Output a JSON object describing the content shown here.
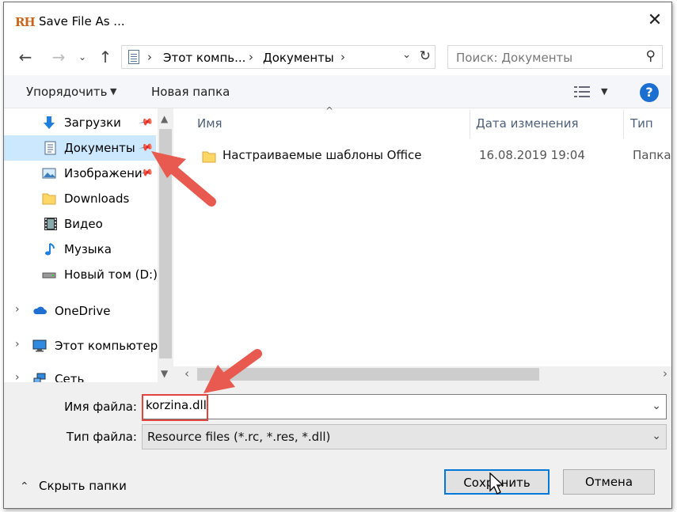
{
  "window": {
    "title": "Save File As ...",
    "app_icon_text": "RH"
  },
  "nav": {
    "breadcrumbs": [
      "Этот компь...",
      "Документы"
    ],
    "search_placeholder": "Поиск: Документы"
  },
  "toolbar": {
    "organize_label": "Упорядочить",
    "new_folder_label": "Новая папка"
  },
  "sidebar": {
    "items": [
      {
        "label": "Загрузки",
        "icon": "download-arrow-icon",
        "pinned": true
      },
      {
        "label": "Документы",
        "icon": "document-icon",
        "pinned": true,
        "selected": true
      },
      {
        "label": "Изображени",
        "icon": "pictures-icon",
        "pinned": true
      },
      {
        "label": "Downloads",
        "icon": "folder-icon"
      },
      {
        "label": "Видео",
        "icon": "video-icon"
      },
      {
        "label": "Музыка",
        "icon": "music-note-icon"
      },
      {
        "label": "Новый том (D:)",
        "icon": "drive-icon"
      },
      {
        "label": "OneDrive",
        "icon": "cloud-icon"
      },
      {
        "label": "Этот компьютер",
        "icon": "computer-icon"
      },
      {
        "label": "Сеть",
        "icon": "network-icon"
      }
    ]
  },
  "files": {
    "columns": [
      "Имя",
      "Дата изменения",
      "Тип"
    ],
    "rows": [
      {
        "name": "Настраиваемые шаблоны Office",
        "date": "16.08.2019 19:04",
        "type": "Папка с"
      }
    ]
  },
  "form": {
    "filename_label": "Имя файла:",
    "filename_value": "korzina.dll",
    "filetype_label": "Тип файла:",
    "filetype_value": "Resource files (*.rc, *.res, *.dll)"
  },
  "footer": {
    "hide_folders_label": "Скрыть папки",
    "save_label": "Сохранить",
    "cancel_label": "Отмена"
  },
  "colors": {
    "accent": "#0078d7",
    "selection": "#cce8ff",
    "annotation": "#e0443c",
    "folder": "#ffd766"
  }
}
